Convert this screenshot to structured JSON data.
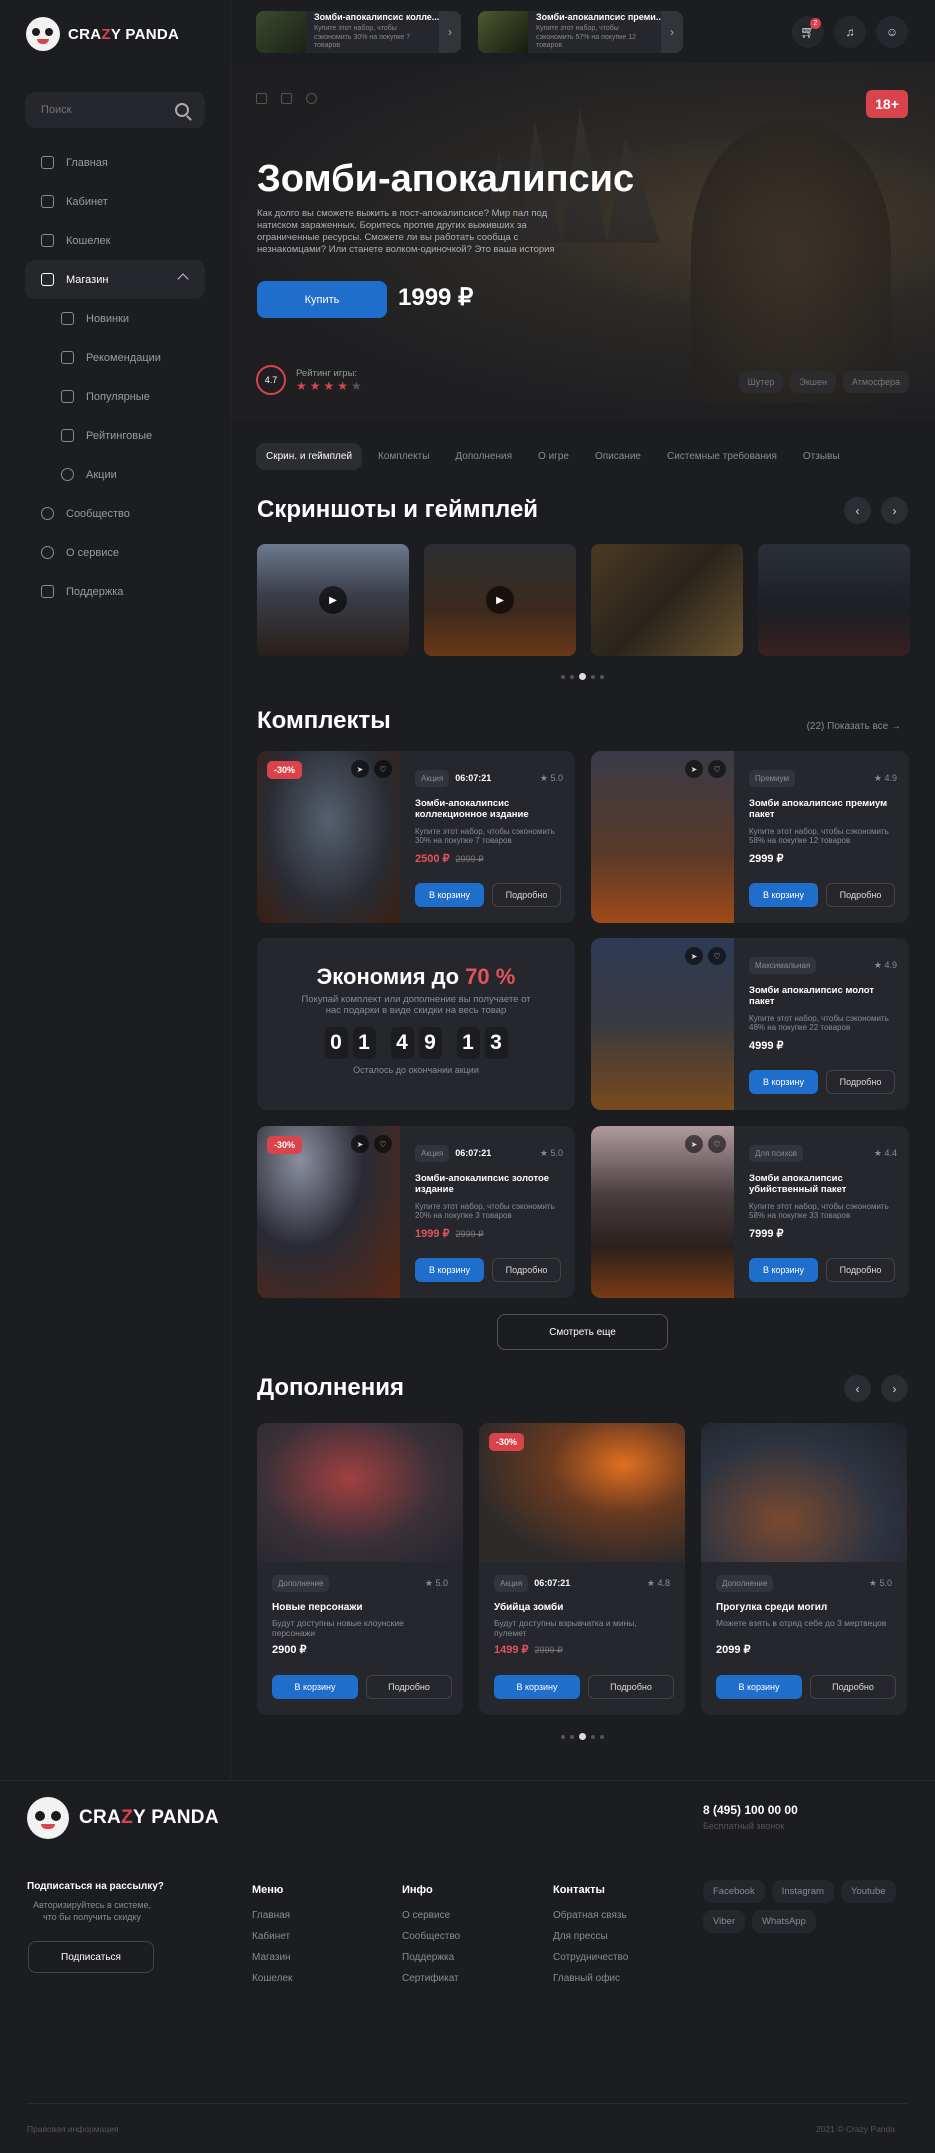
{
  "brand": {
    "name_pre": "CRA",
    "name_z": "Z",
    "name_post": "Y PANDA"
  },
  "search": {
    "placeholder": "Поиск"
  },
  "nav": [
    {
      "label": "Главная",
      "icon": "home-icon"
    },
    {
      "label": "Кабинет",
      "icon": "cabinet-icon"
    },
    {
      "label": "Кошелек",
      "icon": "wallet-icon"
    },
    {
      "label": "Магазин",
      "icon": "shop-icon"
    },
    {
      "label": "Новинки",
      "icon": "bookmark-icon"
    },
    {
      "label": "Рекомендации",
      "icon": "sort-icon"
    },
    {
      "label": "Популярные",
      "icon": "popular-icon"
    },
    {
      "label": "Рейтинговые",
      "icon": "bookmark-icon"
    },
    {
      "label": "Акции",
      "icon": "sale-icon"
    },
    {
      "label": "Сообщество",
      "icon": "community-icon"
    },
    {
      "label": "О сервисе",
      "icon": "chat-icon"
    },
    {
      "label": "Поддержка",
      "icon": "support-icon"
    }
  ],
  "top_cards": [
    {
      "title": "Зомби-апокалипсис колле...",
      "sub": "Купите этот набор, чтобы сэкономить 30% на покупке 7 товаров"
    },
    {
      "title": "Зомби-апокалипсис преми...",
      "sub": "Купите этот набор, чтобы сэкономить 57% на покупке 12 товаров"
    }
  ],
  "cart_count": "2",
  "hero": {
    "age": "18+",
    "title": "Зомби-апокалипсис",
    "desc": "Как долго вы сможете выжить в пост-апокалипсисе? Мир пал под натиском зараженных. Боритесь против других выживших за ограниченные ресурсы. Сможете ли вы работать сообща с незнакомцами? Или станете волком-одиночкой? Это ваша история",
    "buy": "Купить",
    "price": "1999 ₽",
    "rating_value": "4.7",
    "rating_label": "Рейтинг игры:",
    "tags": [
      "Шутер",
      "Экшен",
      "Атмосфера"
    ]
  },
  "tabs": [
    "Скрин. и геймплей",
    "Комплекты",
    "Дополнения",
    "О игре",
    "Описание",
    "Системные требования",
    "Отзывы"
  ],
  "screens_title": "Скриншоты и геймплей",
  "bundles_title": "Комплекты",
  "bundles_count": "(22)",
  "bundles_show_all": "Показать все",
  "bundles": [
    {
      "tag": "Акция",
      "timer": "06:07:21",
      "score": "5.0",
      "title": "Зомби-апокалипсис коллекционное издание",
      "desc": "Купите этот набор, чтобы сэкономить 30% на покупке 7 товаров",
      "price": "2500 ₽",
      "old": "2999 ₽",
      "discount": "-30%"
    },
    {
      "tag": "Премиум",
      "timer": "",
      "score": "4.9",
      "title": "Зомби апокалипсис премиум пакет",
      "desc": "Купите этот набор, чтобы сэкономить 58% на покупке 12 товаров",
      "price": "2999 ₽",
      "old": "",
      "discount": ""
    },
    {
      "tag": "Максимальная",
      "timer": "",
      "score": "4.9",
      "title": "Зомби апокалипсис молот пакет",
      "desc": "Купите этот набор, чтобы сэкономить 48% на покупке 22 товаров",
      "price": "4999 ₽",
      "old": "",
      "discount": ""
    },
    {
      "tag": "Акция",
      "timer": "06:07:21",
      "score": "5.0",
      "title": "Зомби-апокалипсис золотое издание",
      "desc": "Купите этот набор, чтобы сэкономить 20% на покупке 3 товаров",
      "price": "1999 ₽",
      "old": "2999 ₽",
      "discount": "-30%"
    },
    {
      "tag": "Для психов",
      "timer": "",
      "score": "4.4",
      "title": "Зомби апокалипсис убийственный пакет",
      "desc": "Купите этот набор, чтобы сэкономить 58% на покупке 33 товаров",
      "price": "7999 ₽",
      "old": "",
      "discount": ""
    }
  ],
  "promo": {
    "title": "Экономия до",
    "percent": "70 %",
    "sub": "Покупай комплект или дополнение вы получаете от нас подарки в виде скидки на весь товар",
    "digits": [
      "0",
      "1",
      "4",
      "9",
      "1",
      "3"
    ],
    "foot": "Осталось до окончании акции"
  },
  "cart_label": "В корзину",
  "more_label": "Подробно",
  "see_more": "Смотреть еще",
  "addons_title": "Дополнения",
  "addons": [
    {
      "tag": "Дополнение",
      "timer": "",
      "score": "5.0",
      "title": "Новые персонажи",
      "desc": "Будут доступны новые клоунские персонажи",
      "price": "2900 ₽",
      "old": "",
      "discount": ""
    },
    {
      "tag": "Акция",
      "timer": "06:07:21",
      "score": "4.8",
      "title": "Убийца зомби",
      "desc": "Будут доступны взрывчатка и мины, пулемет",
      "price": "1499 ₽",
      "old": "2999 ₽",
      "discount": "-30%"
    },
    {
      "tag": "Дополнение",
      "timer": "",
      "score": "5.0",
      "title": "Прогулка среди могил",
      "desc": "Можете взять в отряд себе до 3 мертвецов",
      "price": "2099 ₽",
      "old": "",
      "discount": ""
    }
  ],
  "footer": {
    "phone": "8 (495) 100 00 00",
    "phone_sub": "Бесплатный звонок",
    "sub_title": "Подписаться на рассылку?",
    "sub_text": "Авторизируйтесь в системе, что бы получить скидку",
    "sub_btn": "Подписаться",
    "menu_title": "Меню",
    "menu": [
      "Главная",
      "Кабинет",
      "Магазин",
      "Кошелек"
    ],
    "info_title": "Инфо",
    "info": [
      "О сервисе",
      "Сообщество",
      "Поддержка",
      "Сертификат"
    ],
    "contacts_title": "Контакты",
    "contacts": [
      "Обратная связь",
      "Для прессы",
      "Сотрудничество",
      "Главный офис"
    ],
    "socials": [
      "Facebook",
      "Instagram",
      "Youtube",
      "Viber",
      "WhatsApp"
    ],
    "legal": "Правовая информация",
    "copy": "2021 © Crazy Panda"
  },
  "colors": {
    "accent": "#1f6ecb",
    "danger": "#d9444c",
    "bg": "#1c1d21",
    "card": "#26272c"
  }
}
